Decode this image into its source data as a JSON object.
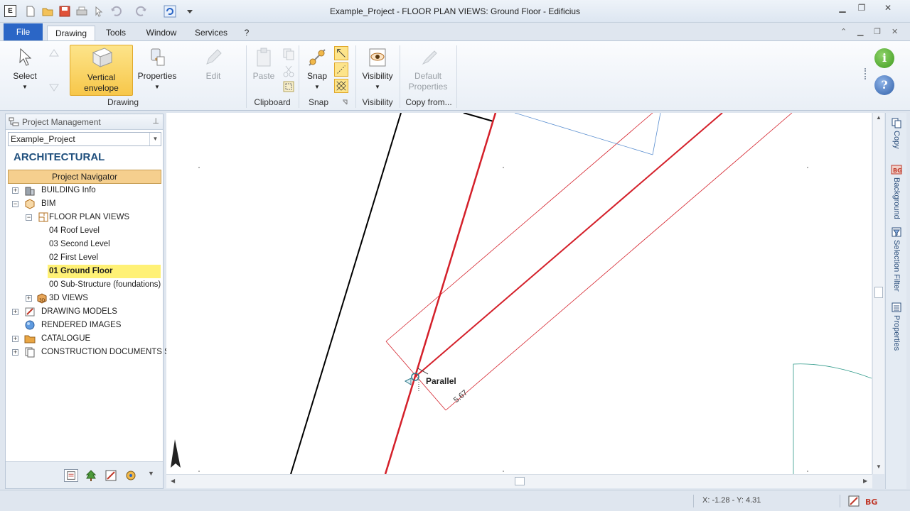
{
  "window": {
    "title": "Example_Project -  FLOOR PLAN VIEWS: Ground Floor - Edificius",
    "app_icon": "E"
  },
  "ribbon_tabs": [
    {
      "label": "File"
    },
    {
      "label": "Drawing"
    },
    {
      "label": "Tools"
    },
    {
      "label": "Window"
    },
    {
      "label": "Services"
    },
    {
      "label": "?"
    }
  ],
  "ribbon": {
    "select": "Select",
    "vertical_envelope": "Vertical envelope",
    "properties": "Properties",
    "edit": "Edit",
    "drawing_group": "Drawing",
    "paste": "Paste",
    "clipboard_group": "Clipboard",
    "snap": "Snap",
    "snap_group": "Snap",
    "visibility": "Visibility",
    "visibility_group": "Visibility",
    "default_properties": "Default Properties",
    "copy_from_group": "Copy from..."
  },
  "panel": {
    "title": "Project Management",
    "project": "Example_Project",
    "section": "ARCHITECTURAL",
    "navigator": "Project Navigator"
  },
  "tree": [
    {
      "label": "BUILDING Info",
      "expander": "+"
    },
    {
      "label": "BIM",
      "expander": "−"
    },
    {
      "label": "FLOOR PLAN VIEWS",
      "expander": "−"
    },
    {
      "label": "04 Roof Level"
    },
    {
      "label": "03 Second Level"
    },
    {
      "label": "02 First Level"
    },
    {
      "label": "01 Ground Floor",
      "selected": true
    },
    {
      "label": "00 Sub-Structure (foundations)"
    },
    {
      "label": "3D VIEWS",
      "expander": "+"
    },
    {
      "label": "DRAWING MODELS",
      "expander": "+"
    },
    {
      "label": "RENDERED IMAGES"
    },
    {
      "label": "CATALOGUE",
      "expander": "+"
    },
    {
      "label": "CONSTRUCTION DOCUMENTS SET",
      "expander": "+"
    }
  ],
  "canvas": {
    "snap_tooltip": "Parallel",
    "dimension": "5.67"
  },
  "dock_tabs": [
    "Copy",
    "Background",
    "Selection Filter",
    "Properties"
  ],
  "status": {
    "coords": "X: -1.28 - Y: 4.31"
  },
  "colors": {
    "accent_blue": "#2b66c6",
    "selected_yellow": "#fff176",
    "navigator_orange": "#f5cf8e",
    "wall_red": "#d4202a"
  }
}
